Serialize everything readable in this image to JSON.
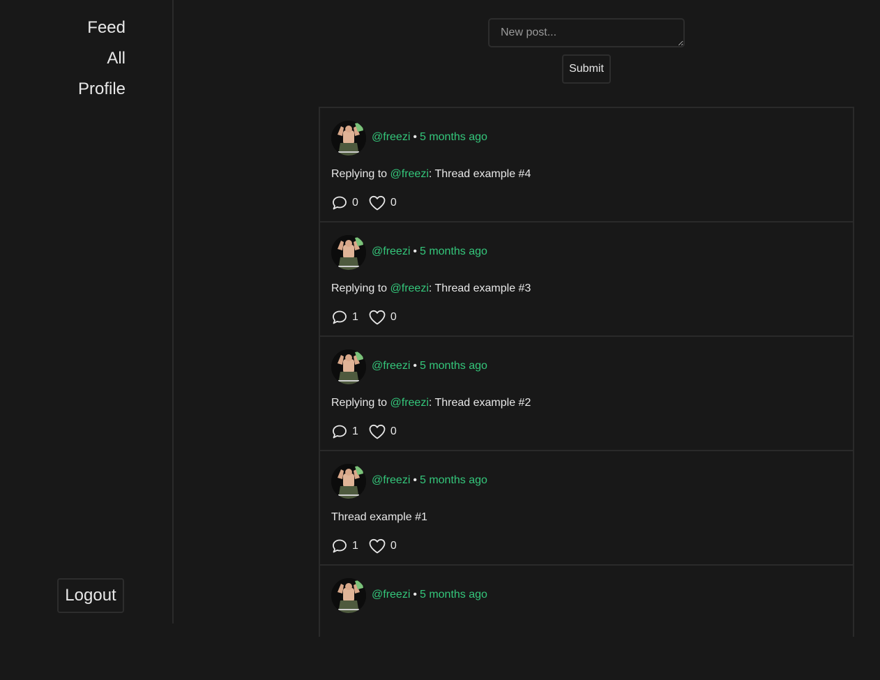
{
  "sidebar": {
    "nav": [
      {
        "label": "Feed"
      },
      {
        "label": "All"
      },
      {
        "label": "Profile"
      }
    ],
    "logout_label": "Logout"
  },
  "composer": {
    "placeholder": "New post...",
    "submit_label": "Submit"
  },
  "posts": [
    {
      "handle": "@freezi",
      "time": "5 months ago",
      "reply_prefix": "Replying to ",
      "reply_to": "@freezi",
      "text": ": Thread example #4",
      "comments": "0",
      "likes": "0"
    },
    {
      "handle": "@freezi",
      "time": "5 months ago",
      "reply_prefix": "Replying to ",
      "reply_to": "@freezi",
      "text": ": Thread example #3",
      "comments": "1",
      "likes": "0"
    },
    {
      "handle": "@freezi",
      "time": "5 months ago",
      "reply_prefix": "Replying to ",
      "reply_to": "@freezi",
      "text": ": Thread example #2",
      "comments": "1",
      "likes": "0"
    },
    {
      "handle": "@freezi",
      "time": "5 months ago",
      "reply_prefix": "",
      "reply_to": "",
      "text": "Thread example #1",
      "comments": "1",
      "likes": "0"
    },
    {
      "handle": "@freezi",
      "time": "5 months ago"
    }
  ],
  "separator": "•",
  "colors": {
    "background": "#181818",
    "accent": "#34c77b",
    "border": "#2a2a2a"
  },
  "icons": {
    "comment": "speech-bubble-icon",
    "like": "heart-icon"
  }
}
